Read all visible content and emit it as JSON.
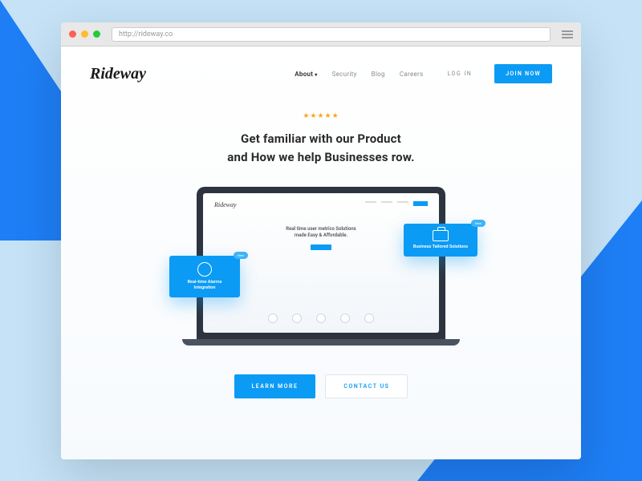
{
  "browser": {
    "url": "http://rideway.co"
  },
  "brand": "Rideway",
  "nav": {
    "items": [
      {
        "label": "About",
        "active": true,
        "dropdown": true
      },
      {
        "label": "Security"
      },
      {
        "label": "Blog"
      },
      {
        "label": "Careers"
      }
    ],
    "login": "LOG IN",
    "join": "JOIN NOW"
  },
  "hero": {
    "stars": "★★★★★",
    "headline_line1": "Get familiar with our Product",
    "headline_line2": "and How we help Businesses row."
  },
  "laptop": {
    "mini_brand": "Rideway",
    "mini_head_line1": "Real time user metrics Solutions",
    "mini_head_line2": "made Easy & Affordable.",
    "card_left": {
      "title": "Real-time Alarms Integration",
      "badge": "New"
    },
    "card_right": {
      "title": "Business Tailored Solutions",
      "badge": "New"
    }
  },
  "cta": {
    "primary": "LEARN MORE",
    "secondary": "CONTACT US"
  },
  "colors": {
    "accent": "#0b9bf4",
    "bg_blue": "#1e7ef5",
    "star": "#f7a623"
  }
}
